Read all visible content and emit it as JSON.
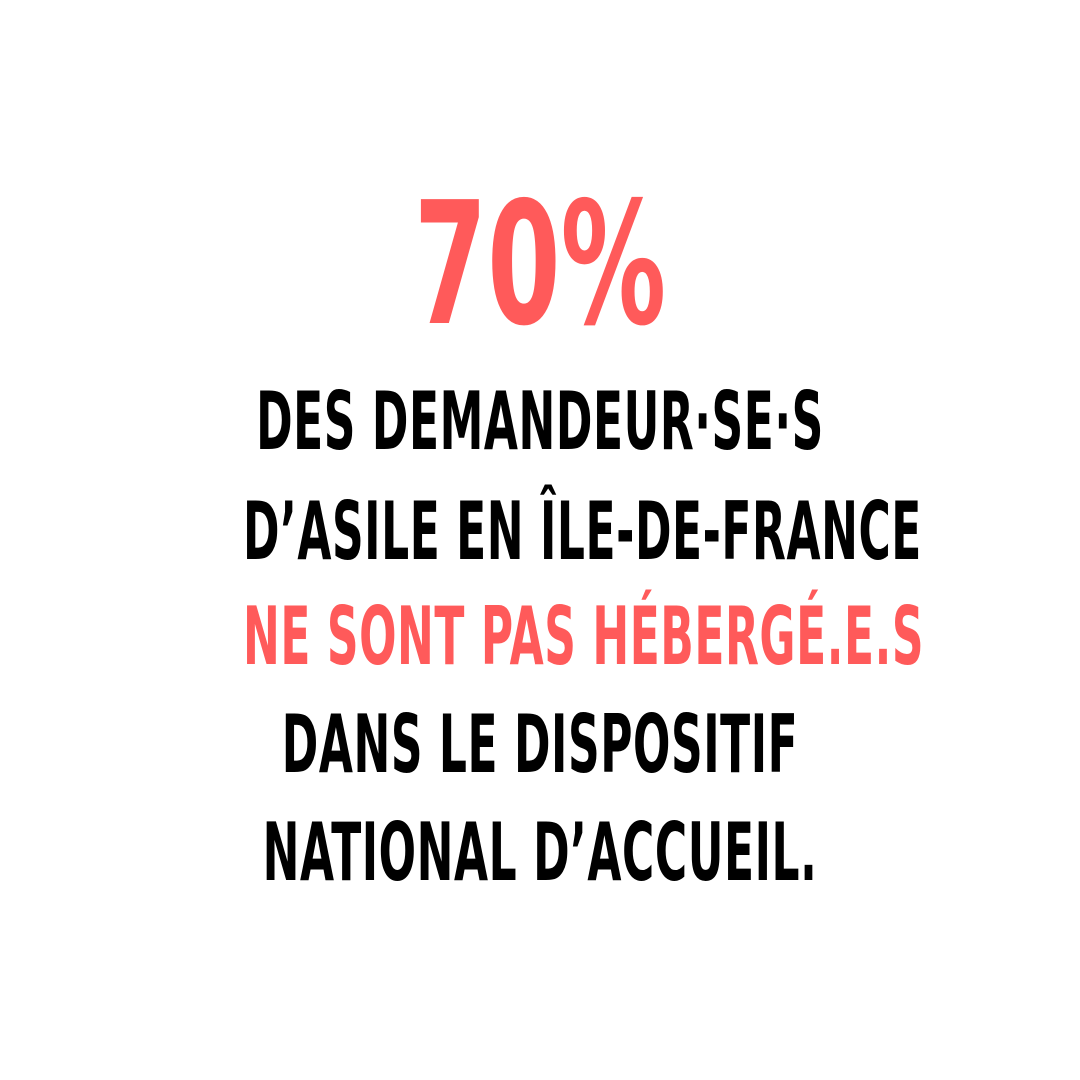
{
  "colors": {
    "accent": "#ff5a5a",
    "text": "#000000",
    "background": "#ffffff"
  },
  "headline": {
    "percent": "70%"
  },
  "body": {
    "line1": "DES DEMANDEUR·SE·S",
    "line2": "D’ASILE EN ÎLE-DE-FRANCE",
    "line3": "NE SONT PAS HÉBERGÉ.E.S",
    "line4": "DANS LE DISPOSITIF",
    "line5": "NATIONAL D’ACCUEIL."
  }
}
